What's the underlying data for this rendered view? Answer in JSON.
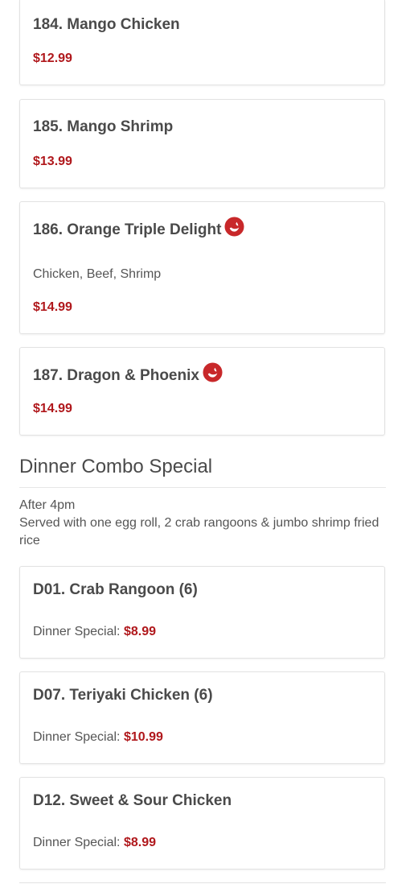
{
  "items_top": [
    {
      "title": "184. Mango Chicken",
      "price": "$12.99",
      "spicy": false,
      "desc": ""
    },
    {
      "title": "185. Mango Shrimp",
      "price": "$13.99",
      "spicy": false,
      "desc": ""
    },
    {
      "title": "186. Orange Triple Delight",
      "price": "$14.99",
      "spicy": true,
      "desc": "Chicken, Beef, Shrimp"
    },
    {
      "title": "187. Dragon & Phoenix",
      "price": "$14.99",
      "spicy": true,
      "desc": ""
    }
  ],
  "section": {
    "title": "Dinner Combo Special",
    "note_line1": "After 4pm",
    "note_line2": "Served with one egg roll, 2 crab rangoons & jumbo shrimp fried rice"
  },
  "combo_items": [
    {
      "title": "D01. Crab Rangoon (6)",
      "label": "Dinner Special:",
      "price": "$8.99"
    },
    {
      "title": "D07. Teriyaki Chicken (6)",
      "label": "Dinner Special:",
      "price": "$10.99"
    },
    {
      "title": "D12. Sweet & Sour Chicken",
      "label": "Dinner Special:",
      "price": "$8.99"
    }
  ],
  "colors": {
    "price": "#b0181c",
    "spicy_icon": "#c8282a",
    "text": "#4a4a4a"
  },
  "icons": {
    "spicy": "chili-pepper-icon"
  }
}
